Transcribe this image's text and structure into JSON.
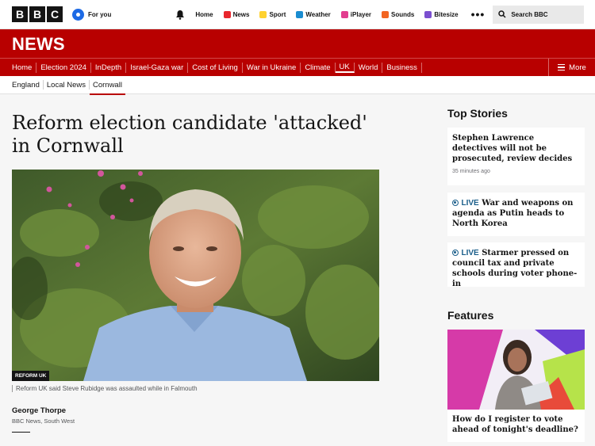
{
  "brand": {
    "letters": [
      "B",
      "B",
      "C"
    ]
  },
  "topbar": {
    "for_you": "For you",
    "nav": [
      {
        "label": "Home",
        "icon": ""
      },
      {
        "label": "News",
        "icon": "news-icon",
        "color": "#e8262d"
      },
      {
        "label": "Sport",
        "icon": "sport-icon",
        "color": "#ffd230"
      },
      {
        "label": "Weather",
        "icon": "weather-icon",
        "color": "#1a8cd0"
      },
      {
        "label": "iPlayer",
        "icon": "iplayer-icon",
        "color": "#e23d8f"
      },
      {
        "label": "Sounds",
        "icon": "sounds-icon",
        "color": "#f26522"
      },
      {
        "label": "Bitesize",
        "icon": "bitesize-icon",
        "color": "#7b4fd0"
      }
    ],
    "search_placeholder": "Search BBC"
  },
  "banner": {
    "title": "NEWS"
  },
  "section_nav": {
    "items": [
      "Home",
      "Election 2024",
      "InDepth",
      "Israel-Gaza war",
      "Cost of Living",
      "War in Ukraine",
      "Climate",
      "UK",
      "World",
      "Business"
    ],
    "active": "UK",
    "more": "More"
  },
  "sub_nav": {
    "items": [
      "England",
      "Local News",
      "Cornwall"
    ],
    "active": "Cornwall"
  },
  "article": {
    "headline": "Reform election candidate 'attacked' in Cornwall",
    "image_tag": "REFORM UK",
    "caption": "Reform UK said Steve Rubidge was assaulted while in Falmouth",
    "author": "George Thorpe",
    "author_org": "BBC News, South West"
  },
  "sidebar": {
    "top_stories_heading": "Top Stories",
    "stories": [
      {
        "title": "Stephen Lawrence detectives will not be prosecuted, review decides",
        "time": "35 minutes ago",
        "live": false
      },
      {
        "title": "War and weapons on agenda as Putin heads to North Korea",
        "live": true,
        "live_label": "LIVE"
      },
      {
        "title": "Starmer pressed on council tax and private schools during voter phone-in",
        "live": true,
        "live_label": "LIVE"
      }
    ],
    "features_heading": "Features",
    "feature": {
      "title": "How do I register to vote ahead of tonight's deadline?"
    }
  }
}
